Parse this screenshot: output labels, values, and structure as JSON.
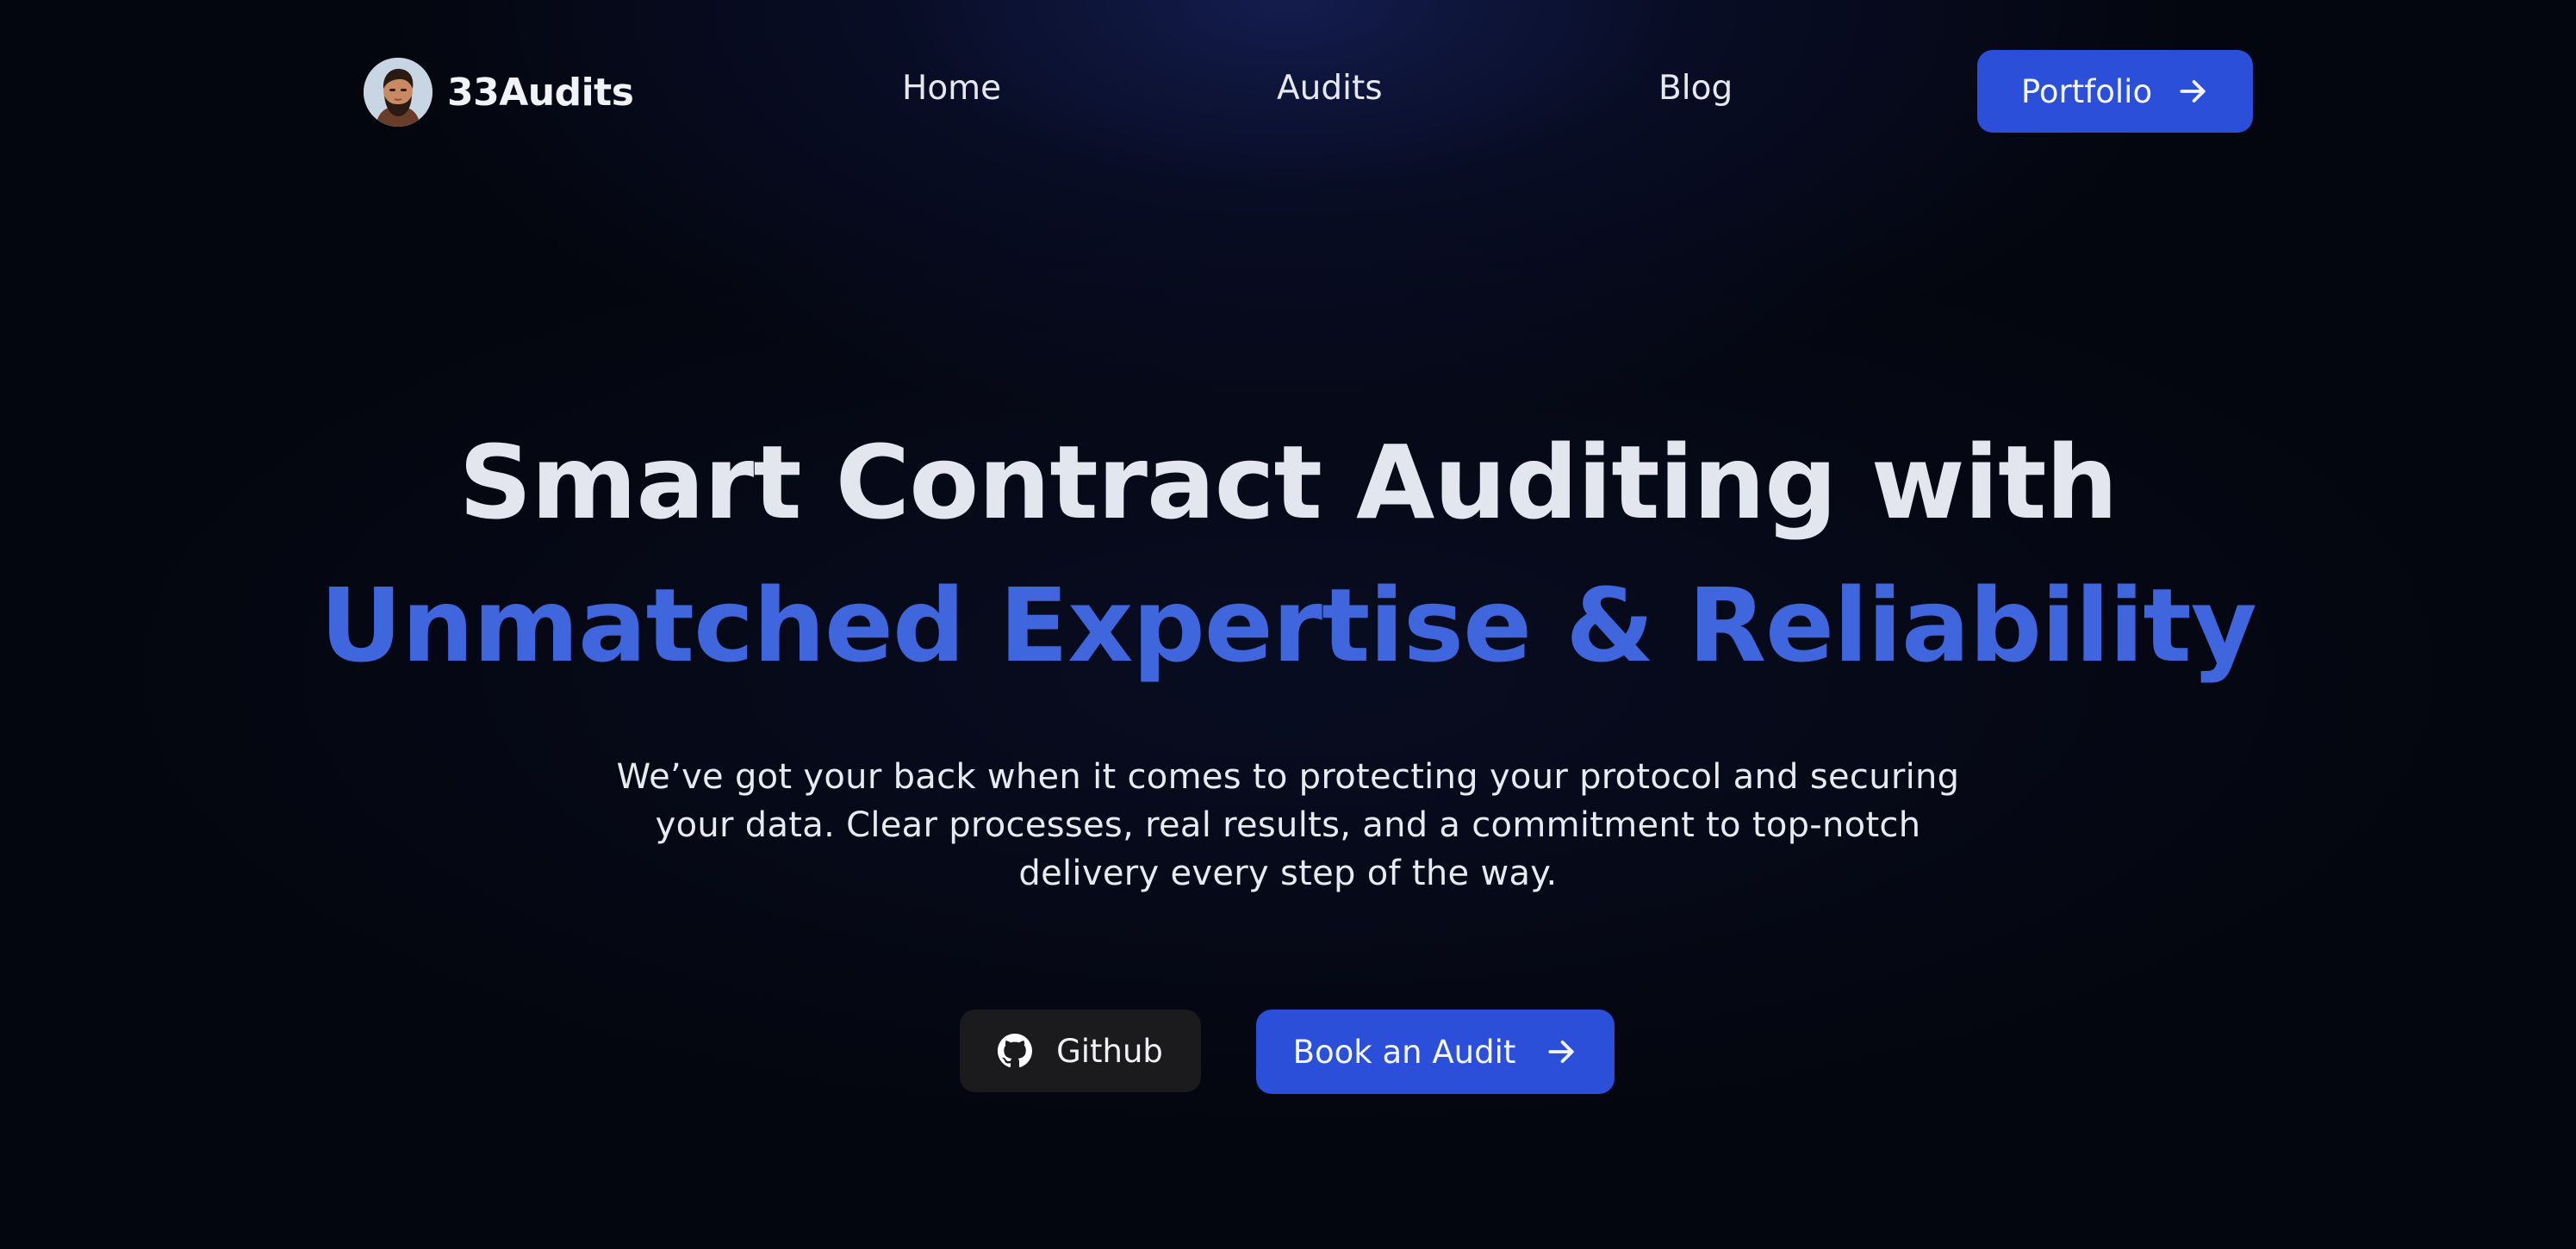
{
  "nav": {
    "brand_name": "33Audits",
    "links": {
      "home": "Home",
      "audits": "Audits",
      "blog": "Blog"
    },
    "portfolio_label": "Portfolio"
  },
  "hero": {
    "title_line1": "Smart Contract Auditing with",
    "title_line2": "Unmatched Expertise & Reliability",
    "description": "We’ve got your back when it comes to protecting your protocol and securing your data. Clear processes, real results, and a commitment to top-notch delivery every step of the way.",
    "github_label": "Github",
    "book_label": "Book an Audit"
  },
  "icons": {
    "avatar": "avatar-image",
    "portfolio_arrow": "arrow-right-icon",
    "github": "github-icon",
    "book_arrow": "arrow-right-icon"
  },
  "colors": {
    "background": "#04060f",
    "accent": "#2b4fd8",
    "title_accent": "#3f66dc",
    "github_button": "#1b1b1e"
  }
}
